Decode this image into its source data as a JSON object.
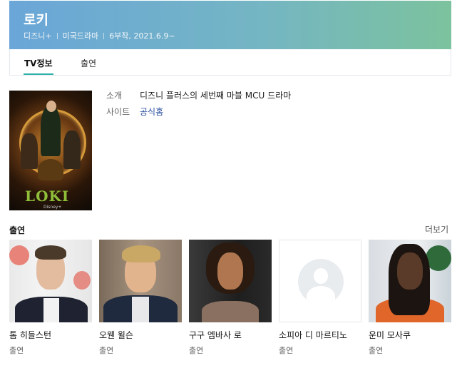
{
  "header": {
    "title": "로키",
    "channel": "디즈니+",
    "genre": "미국드라마",
    "episodes": "6부작, 2021.6.9~"
  },
  "tabs": [
    {
      "label": "TV정보",
      "active": true
    },
    {
      "label": "출연",
      "active": false
    }
  ],
  "info": {
    "intro_label": "소개",
    "intro_value": "디즈니 플러스의 세번째 마블 MCU 드라마",
    "site_label": "사이트",
    "site_value": "공식홈"
  },
  "poster": {
    "logo_text": "LOKI",
    "studio_text": "Disney+"
  },
  "cast_section": {
    "title": "출연",
    "more_label": "더보기"
  },
  "cast": [
    {
      "name": "톰 히들스턴",
      "role": "출연"
    },
    {
      "name": "오웬 윌슨",
      "role": "출연"
    },
    {
      "name": "구구 엠바사 로",
      "role": "출연"
    },
    {
      "name": "소피아 디 마르티노",
      "role": "출연"
    },
    {
      "name": "운미 모사쿠",
      "role": "출연"
    }
  ],
  "colors": {
    "accent": "#2bb1a8",
    "header_start": "#6aa6d8",
    "header_end": "#7cc29e",
    "link": "#2a4fa0"
  }
}
